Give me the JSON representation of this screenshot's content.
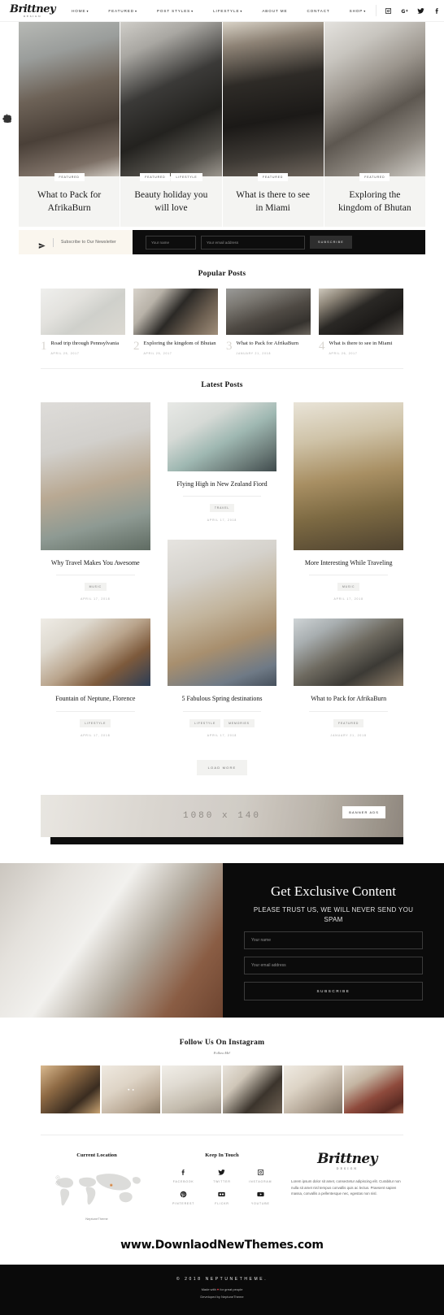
{
  "header": {
    "logo": "Brittney",
    "logo_sub": "DESIGN",
    "nav": [
      {
        "label": "HOME",
        "caret": "▾"
      },
      {
        "label": "FEATURED",
        "caret": "▾"
      },
      {
        "label": "POST STYLES",
        "caret": "▾"
      },
      {
        "label": "LIFESTYLE",
        "caret": "▾"
      },
      {
        "label": "ABOUT ME",
        "caret": ""
      },
      {
        "label": "CONTACT",
        "caret": ""
      },
      {
        "label": "SHOP",
        "caret": "▾"
      }
    ],
    "social": [
      "instagram-icon",
      "google-plus-icon",
      "twitter-icon",
      "facebook-icon",
      "search-icon"
    ]
  },
  "featured": [
    {
      "title": "What to Pack for AfrikaBurn",
      "tags": [
        "FEATURED"
      ]
    },
    {
      "title": "Beauty holiday you will love",
      "tags": [
        "FEATURED",
        "LIFESTYLE"
      ]
    },
    {
      "title": "What is there to see in Miami",
      "tags": [
        "FEATURED"
      ]
    },
    {
      "title": "Exploring the kingdom of Bhutan",
      "tags": [
        "FEATURED"
      ]
    }
  ],
  "newsletter_bar": {
    "label": "Subscribe to Our Newsletter",
    "name_placeholder": "Your name",
    "email_placeholder": "Your email address",
    "button": "SUBSCRIBE"
  },
  "popular": {
    "title": "Popular Posts",
    "posts": [
      {
        "num": "1",
        "title": "Road trip through Pennsylvania",
        "date": "APRIL 25, 2017"
      },
      {
        "num": "2",
        "title": "Exploring the kingdom of Bhutan",
        "date": "APRIL 25, 2017"
      },
      {
        "num": "3",
        "title": "What to Pack for AfrikaBurn",
        "date": "JANUARY 21, 2018"
      },
      {
        "num": "4",
        "title": "What is there to see in Miami",
        "date": "APRIL 26, 2017"
      }
    ]
  },
  "latest": {
    "title": "Latest Posts",
    "load_more": "LOAD MORE",
    "posts": [
      {
        "title": "Why Travel Makes You Awesome",
        "tags": [
          "MUSIC"
        ],
        "date": "APRIL 17, 2018"
      },
      {
        "title": "Flying High in New Zealand Fiord",
        "tags": [
          "TRAVEL"
        ],
        "date": "APRIL 17, 2018"
      },
      {
        "title": "More Interesting While Traveling",
        "tags": [
          "MUSIC"
        ],
        "date": "APRIL 17, 2018"
      },
      {
        "title": "Fountain of Neptune, Florence",
        "tags": [
          "LIFESTYLE"
        ],
        "date": "APRIL 17, 2018"
      },
      {
        "title": "5 Fabulous Spring destinations",
        "tags": [
          "LIFESTYLE",
          "MEMORIES"
        ],
        "date": "APRIL 17, 2018"
      },
      {
        "title": "What to Pack for AfrikaBurn",
        "tags": [
          "FEATURED"
        ],
        "date": "JANUARY 21, 2018"
      }
    ]
  },
  "banner": {
    "size_text": "1080 x 140",
    "badge": "BANNER ADS"
  },
  "exclusive": {
    "title": "Get Exclusive Content",
    "subtitle": "PLEASE TRUST US, WE WILL NEVER SEND YOU SPAM",
    "name_placeholder": "Your name",
    "email_placeholder": "Your email address",
    "button": "SUBSCRIBE"
  },
  "instagram": {
    "title": "Follow Us On Instagram",
    "subtitle": "Follow Me!"
  },
  "footer": {
    "location_title": "Current Location",
    "map_credit": "NeptuneTheme",
    "touch_title": "Keep In Touch",
    "socials": [
      {
        "icon": "facebook-icon",
        "label": "FACEBOOK"
      },
      {
        "icon": "twitter-icon",
        "label": "TWITTER"
      },
      {
        "icon": "instagram-icon",
        "label": "INSTAGRAM"
      },
      {
        "icon": "pinterest-icon",
        "label": "PINTEREST"
      },
      {
        "icon": "flickr-icon",
        "label": "FLICKR"
      },
      {
        "icon": "youtube-icon",
        "label": "YOUTUBE"
      }
    ],
    "logo": "Brittney",
    "logo_sub": "DESIGN",
    "about_text": "Lorem ipsum dolor sit amet, consectetur adipiscing elit. Curabitur non nulla sit amet nisl tempus convallis quis ac lectus. Praesent sapien massa, convallis a pellentesque nec, egestas non nisl."
  },
  "watermark": "www.DownlaodNewThemes.com",
  "bottom": {
    "copyright": "© 2018 NEPTUNETHEME.",
    "made_prefix": "Made with ",
    "made_heart": "♥",
    "made_suffix": " for great people",
    "developed": "Developed by NeptuneTheme"
  }
}
